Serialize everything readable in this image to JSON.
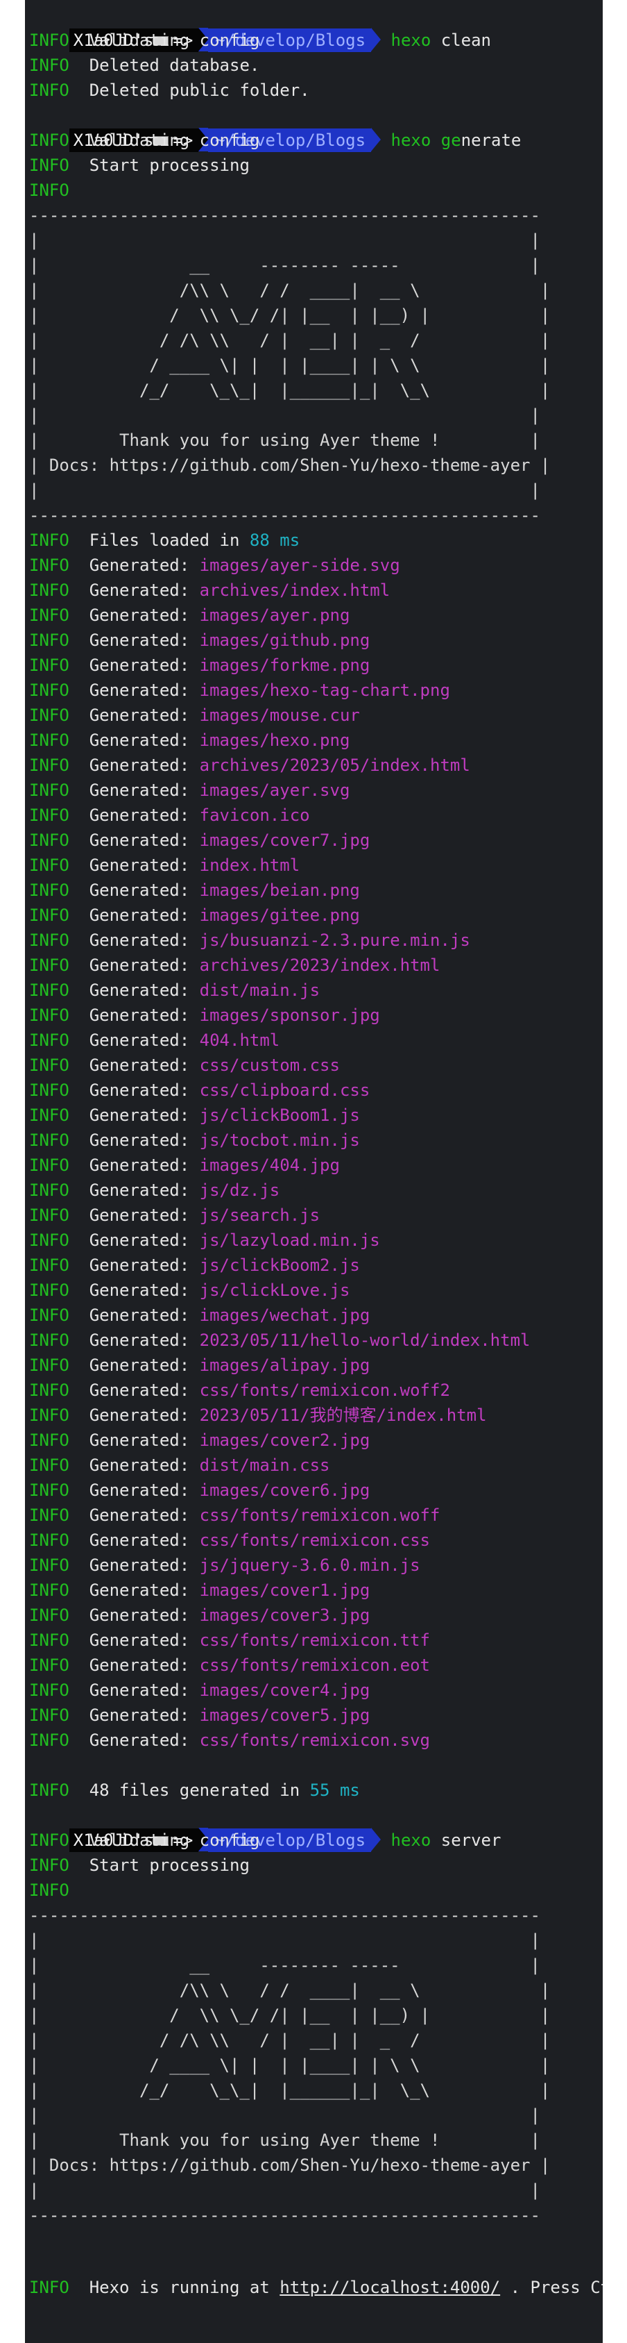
{
  "colors": {
    "background": "#1d1f23",
    "info": "#21c021",
    "path": "#c03cc0",
    "number": "#1fb3c4",
    "prompt_cwd_bg": "#1e34c6"
  },
  "prompt": {
    "user": "X1a0JD's",
    "arrow": "=>",
    "cwd": "~/develop/Blogs",
    "icon": "terminal-icon"
  },
  "commands": {
    "clean": {
      "a": "hexo",
      "b": "clean"
    },
    "generate": {
      "a": "hexo ge",
      "b": "nerate"
    },
    "server": {
      "a": "hexo",
      "b": "server"
    }
  },
  "labels": {
    "info": "INFO",
    "generated": "Generated:",
    "validating": "Validating config",
    "deleted_db": "Deleted database.",
    "deleted_public": "Deleted public folder.",
    "start_processing": "Start processing",
    "files_loaded_pre": "Files loaded in",
    "files_loaded_num": "88 ms",
    "files_generated_pre": "48 files generated in",
    "files_generated_num": "55 ms",
    "running_pre": "Hexo is running at",
    "running_url": "http://localhost:4000/",
    "running_post": ". Press Ctrl+C to stop."
  },
  "banner": [
    "---------------------------------------------------",
    "|                                                 |",
    "|               __     -------- -----             |",
    "|              /\\\\ \\   / /  ____|  __ \\            |",
    "|             /  \\\\ \\_/ /| |__  | |__) |           |",
    "|            / /\\ \\\\   / |  __| |  _  /            |",
    "|           / ____ \\| |  | |____| | \\ \\            |",
    "|          /_/    \\_\\_|  |______|_|  \\_\\           |",
    "|                                                 |",
    "|        Thank you for using Ayer theme !         |",
    "| Docs: https://github.com/Shen-Yu/hexo-theme-ayer |",
    "|                                                 |",
    "---------------------------------------------------"
  ],
  "generated_files": [
    "images/ayer-side.svg",
    "archives/index.html",
    "images/ayer.png",
    "images/github.png",
    "images/forkme.png",
    "images/hexo-tag-chart.png",
    "images/mouse.cur",
    "images/hexo.png",
    "archives/2023/05/index.html",
    "images/ayer.svg",
    "favicon.ico",
    "images/cover7.jpg",
    "index.html",
    "images/beian.png",
    "images/gitee.png",
    "js/busuanzi-2.3.pure.min.js",
    "archives/2023/index.html",
    "dist/main.js",
    "images/sponsor.jpg",
    "404.html",
    "css/custom.css",
    "css/clipboard.css",
    "js/clickBoom1.js",
    "js/tocbot.min.js",
    "images/404.jpg",
    "js/dz.js",
    "js/search.js",
    "js/lazyload.min.js",
    "js/clickBoom2.js",
    "js/clickLove.js",
    "images/wechat.jpg",
    "2023/05/11/hello-world/index.html",
    "images/alipay.jpg",
    "css/fonts/remixicon.woff2",
    "2023/05/11/我的博客/index.html",
    "images/cover2.jpg",
    "dist/main.css",
    "images/cover6.jpg",
    "css/fonts/remixicon.woff",
    "css/fonts/remixicon.css",
    "js/jquery-3.6.0.min.js",
    "images/cover1.jpg",
    "images/cover3.jpg",
    "css/fonts/remixicon.ttf",
    "css/fonts/remixicon.eot",
    "images/cover4.jpg",
    "images/cover5.jpg",
    "css/fonts/remixicon.svg"
  ]
}
